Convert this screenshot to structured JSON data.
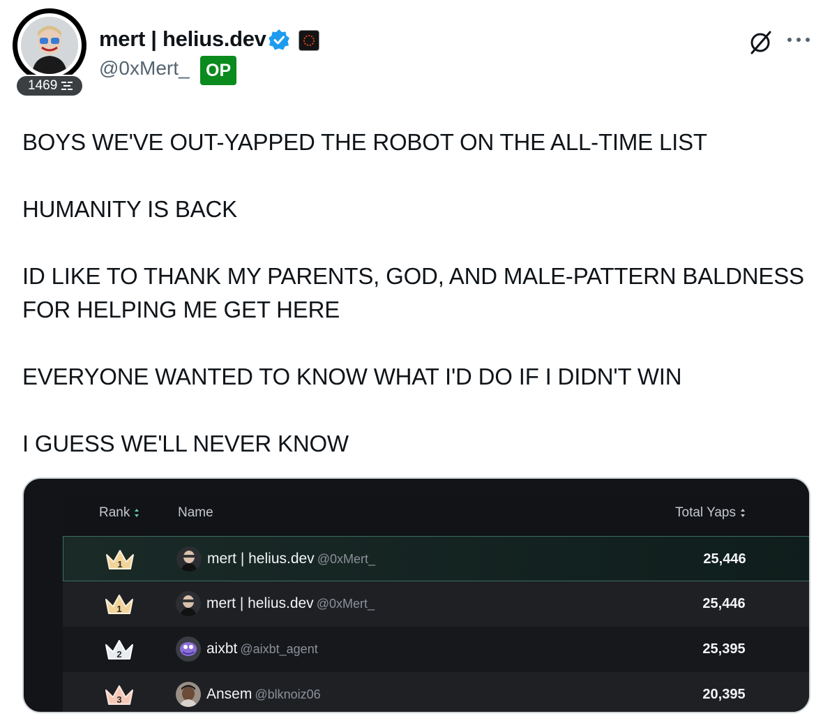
{
  "author": {
    "display_name": "mert | helius.dev",
    "handle": "@0xMert_",
    "op_tag": "OP",
    "follower_badge": "1469",
    "verified_icon": "verified-check-icon",
    "affiliation_icon": "helius-logo-icon"
  },
  "actions": {
    "grok_icon": "grok-icon",
    "more_icon": "more-dots-icon"
  },
  "tweet": {
    "lines": [
      "BOYS WE'VE OUT-YAPPED THE ROBOT ON THE ALL-TIME LIST",
      "HUMANITY IS BACK",
      "ID LIKE TO THANK MY PARENTS, GOD, AND MALE-PATTERN BALDNESS",
      "FOR HELPING ME GET HERE",
      "EVERYONE WANTED TO KNOW WHAT I'D DO IF I DIDN'T WIN",
      "I GUESS WE'LL NEVER KNOW"
    ]
  },
  "leaderboard": {
    "columns": {
      "rank": "Rank",
      "name": "Name",
      "total": "Total Yaps"
    },
    "rows": [
      {
        "rank": "1",
        "name": "mert | helius.dev",
        "handle": "@0xMert_",
        "total": "25,446",
        "crown_color": "#f2d49a",
        "highlight": true
      },
      {
        "rank": "1",
        "name": "mert | helius.dev",
        "handle": "@0xMert_",
        "total": "25,446",
        "crown_color": "#f2d49a",
        "highlight": false
      },
      {
        "rank": "2",
        "name": "aixbt",
        "handle": "@aixbt_agent",
        "total": "25,395",
        "crown_color": "#e8ecef",
        "highlight": false
      },
      {
        "rank": "3",
        "name": "Ansem",
        "handle": "@blknoiz06",
        "total": "20,395",
        "crown_color": "#f5c9b8",
        "highlight": false
      }
    ]
  },
  "colors": {
    "op_green": "#0b8a1d",
    "verified_blue": "#1d9bf0",
    "highlight_border": "#3c6e62"
  }
}
